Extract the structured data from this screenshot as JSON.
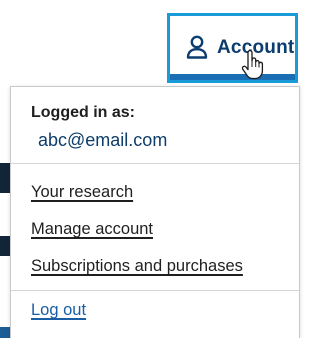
{
  "header": {
    "account_label": "Account"
  },
  "dropdown": {
    "logged_in_label": "Logged in as:",
    "email": "abc@email.com",
    "links": [
      {
        "label": "Your research"
      },
      {
        "label": "Manage account"
      },
      {
        "label": "Subscriptions and purchases"
      }
    ],
    "logout_label": "Log out"
  },
  "colors": {
    "account_border": "#1a9bd8",
    "account_text": "#0b3d6e",
    "logout_link": "#1a5fa6"
  },
  "icons": {
    "account": "user-icon",
    "cursor": "hand-pointer-icon"
  }
}
